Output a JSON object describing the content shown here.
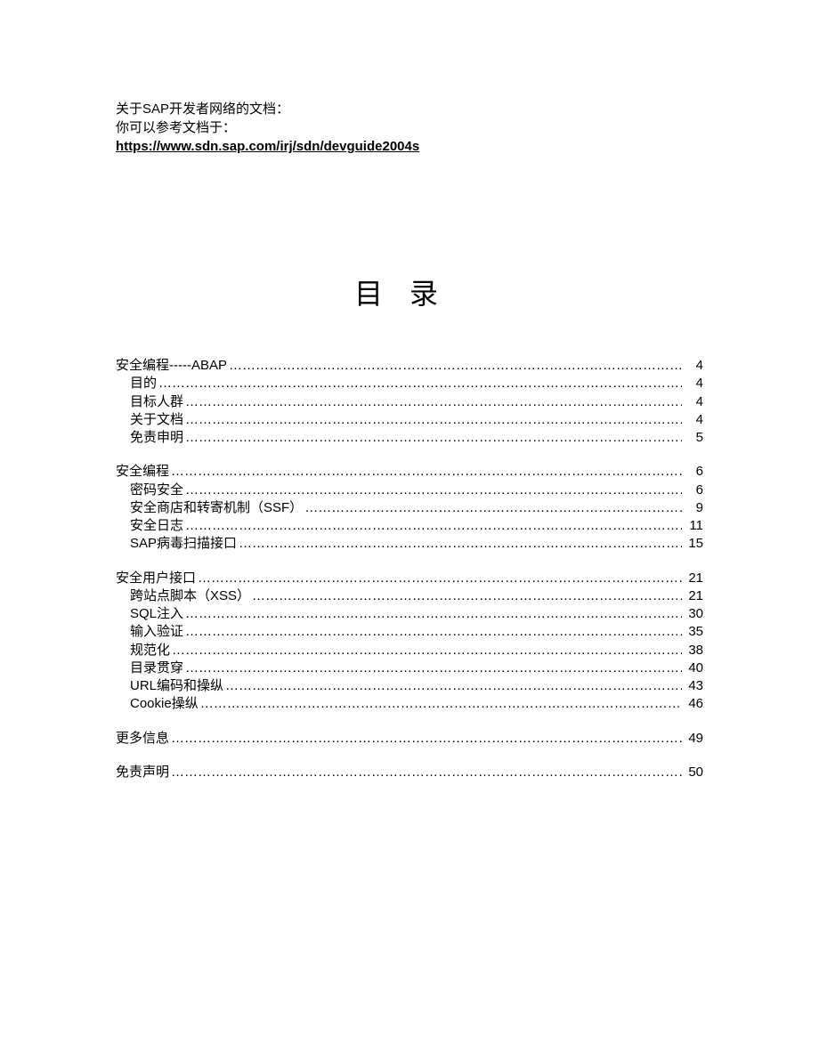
{
  "header": {
    "line1": "关于SAP开发者网络的文档：",
    "line2": "你可以参考文档于：",
    "link": "https://www.sdn.sap.com/irj/sdn/devguide2004s"
  },
  "toc_title": "目录",
  "sections": [
    {
      "entries": [
        {
          "label": "安全编程-----ABAP",
          "page": "4",
          "sub": false
        },
        {
          "label": "目的",
          "page": "4",
          "sub": true
        },
        {
          "label": "目标人群",
          "page": "4",
          "sub": true
        },
        {
          "label": "关于文档",
          "page": "4",
          "sub": true
        },
        {
          "label": "免责申明",
          "page": "5",
          "sub": true
        }
      ]
    },
    {
      "entries": [
        {
          "label": "安全编程",
          "page": "6",
          "sub": false
        },
        {
          "label": "密码安全",
          "page": "6",
          "sub": true
        },
        {
          "label": "安全商店和转寄机制（SSF）",
          "page": "9",
          "sub": true
        },
        {
          "label": "安全日志",
          "page": "11",
          "sub": true
        },
        {
          "label": "SAP病毒扫描接口",
          "page": "15",
          "sub": true
        }
      ]
    },
    {
      "entries": [
        {
          "label": "安全用户接口",
          "page": "21",
          "sub": false
        },
        {
          "label": "跨站点脚本（XSS）",
          "page": "21",
          "sub": true
        },
        {
          "label": "SQL注入",
          "page": "30",
          "sub": true
        },
        {
          "label": "输入验证",
          "page": "35",
          "sub": true
        },
        {
          "label": "规范化",
          "page": "38",
          "sub": true
        },
        {
          "label": "目录贯穿",
          "page": "40",
          "sub": true
        },
        {
          "label": "URL编码和操纵",
          "page": "43",
          "sub": true
        },
        {
          "label": "Cookie操纵",
          "page": "46",
          "sub": true
        }
      ]
    },
    {
      "entries": [
        {
          "label": "更多信息",
          "page": "49",
          "sub": false
        }
      ]
    },
    {
      "entries": [
        {
          "label": "免责声明",
          "page": "50",
          "sub": false
        }
      ]
    }
  ]
}
